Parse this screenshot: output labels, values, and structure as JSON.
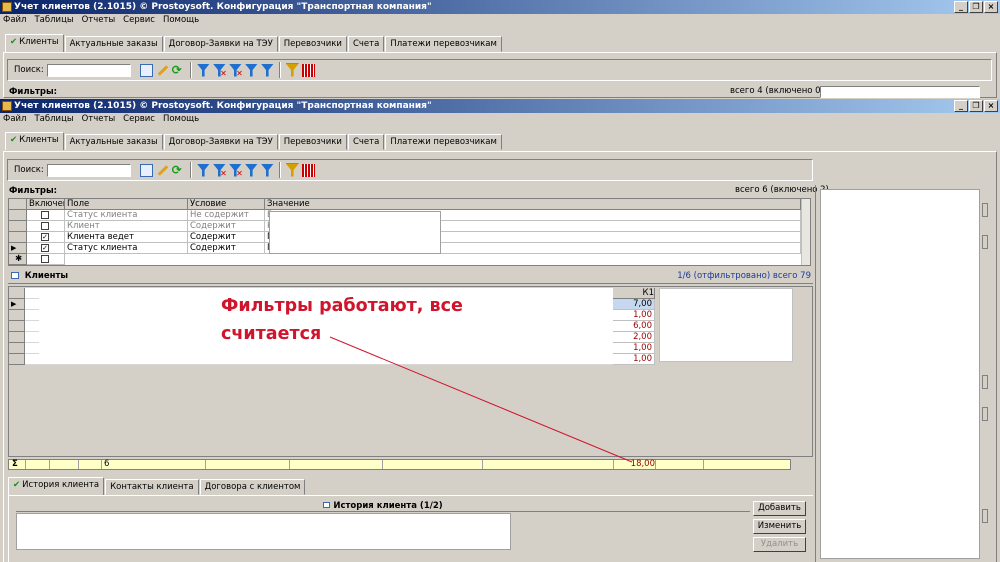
{
  "window": {
    "title": "Учет клиентов (2.1015) © Prostoysoft. Конфигурация \"Транспортная компания\""
  },
  "menu": [
    "Файл",
    "Таблицы",
    "Отчеты",
    "Сервис",
    "Помощь"
  ],
  "tabs": [
    "Клиенты",
    "Актуальные заказы",
    "Договор-Заявки на ТЭУ",
    "Перевозчики",
    "Счета",
    "Платежи перевозчикам"
  ],
  "toolbar": {
    "search_label": "Поиск:"
  },
  "bg": {
    "filters_label": "Фильтры:",
    "filters_total": "всего 4 (включено 0)"
  },
  "filters": {
    "label": "Фильтры:",
    "total": "всего 6 (включено 2)",
    "columns": [
      "Включен",
      "Поле",
      "Условие",
      "Значение"
    ],
    "rows": [
      {
        "field": "Статус клиента",
        "cond": "Не содержит",
        "value": "В",
        "checked": false,
        "dim": true
      },
      {
        "field": "Клиент",
        "cond": "Содержит",
        "value": "К",
        "checked": false,
        "dim": true
      },
      {
        "field": "Клиента ведет",
        "cond": "Содержит",
        "value": "П",
        "checked": true,
        "dim": false
      },
      {
        "field": "Статус клиента",
        "cond": "Содержит",
        "value": "П",
        "checked": true,
        "dim": false
      }
    ]
  },
  "clients": {
    "title": "Клиенты",
    "count": "1/6 (отфильтровано) всего 79",
    "k1_header": "К1",
    "k1_values": [
      "7,00",
      "1,00",
      "6,00",
      "2,00",
      "1,00",
      "1,00"
    ],
    "footer_count": "6",
    "footer_sum": "18,00"
  },
  "annotation": {
    "line1": "Фильтры работают, все",
    "line2": "считается"
  },
  "bottom": {
    "tabs": [
      "История клиента",
      "Контакты клиента",
      "Договора с клиентом"
    ],
    "history_title": "История клиента (1/2)",
    "buttons": {
      "add": "Добавить",
      "edit": "Изменить",
      "delete": "Удалить"
    }
  },
  "colors": {
    "titlebar": "#0a246a",
    "footer": "#ffffc8",
    "annotation": "#d0142c",
    "k1_selected": "#c6d8f0"
  }
}
